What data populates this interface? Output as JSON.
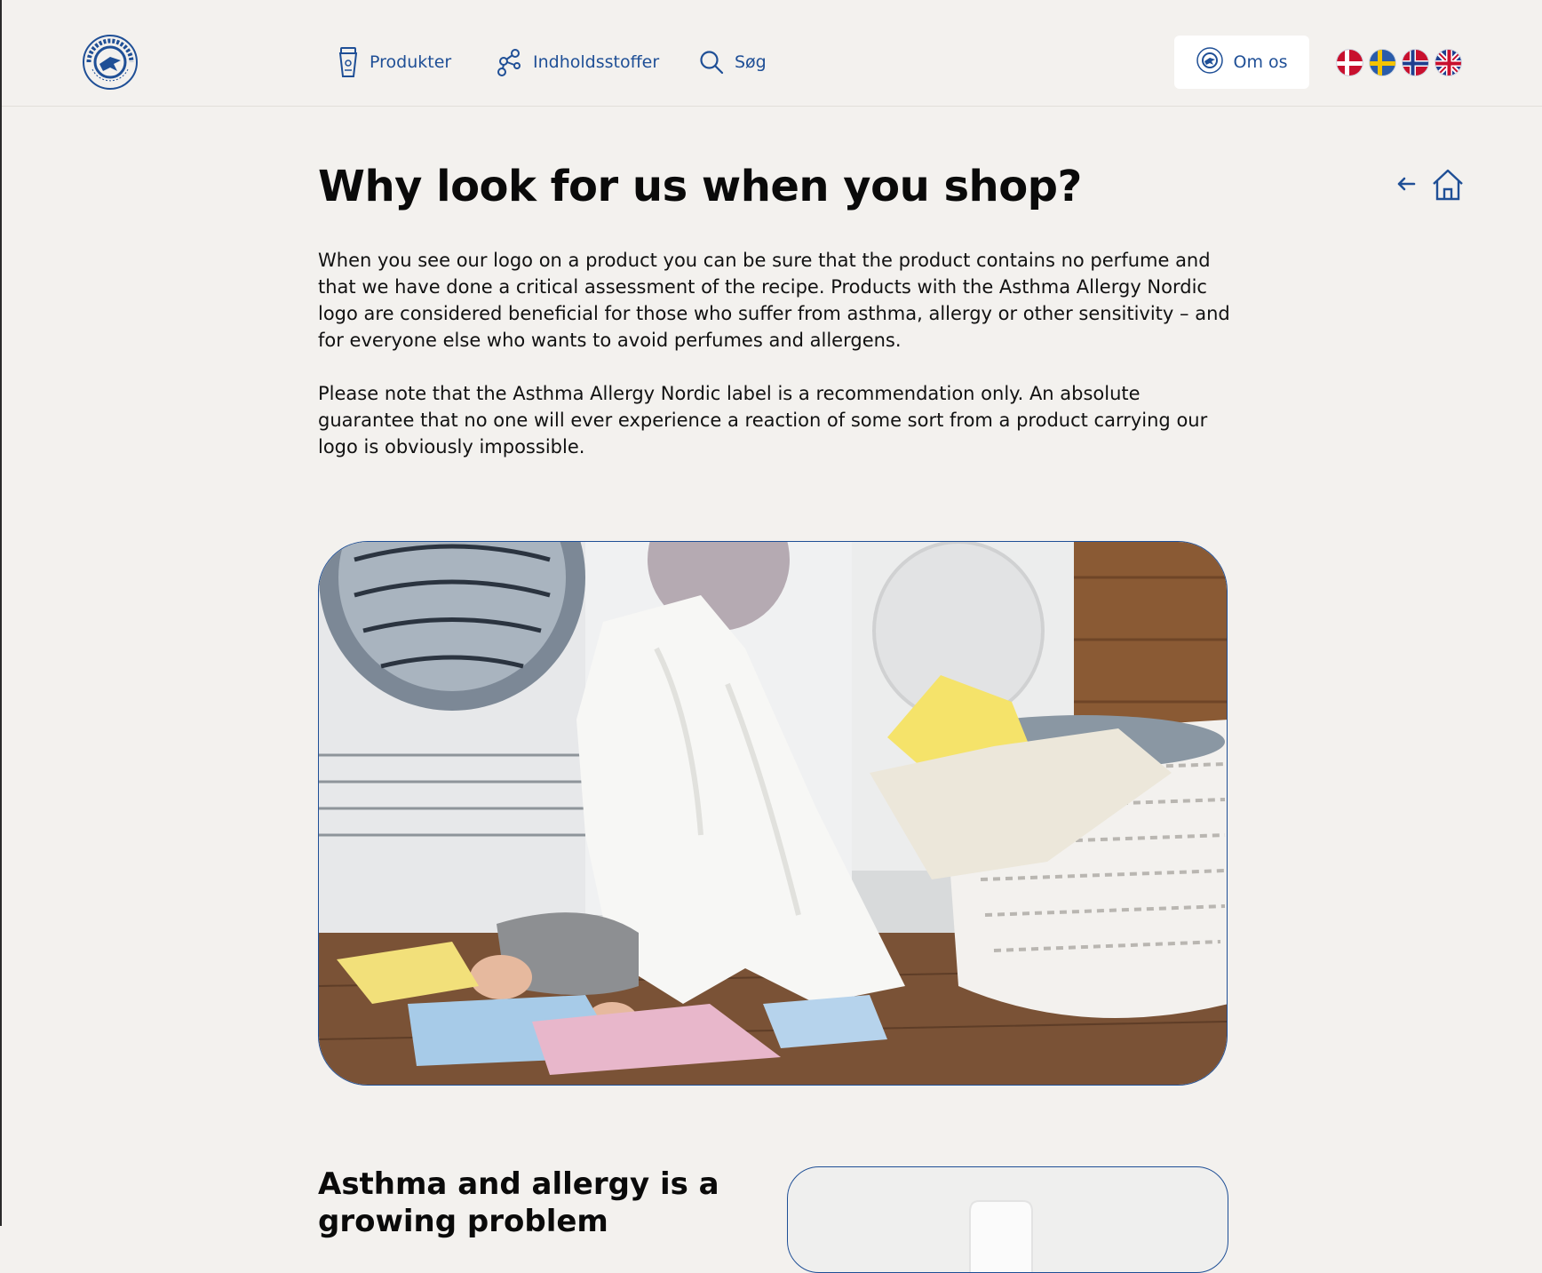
{
  "colors": {
    "accent": "#1f4f96",
    "background": "#f3f1ee",
    "text": "#111111"
  },
  "header": {
    "logo": {
      "icon": "asthma-allergy-nordic-seal",
      "text": "ASTHMA ALLERGY NORDIC · SELECTED WITH CARE"
    },
    "nav": [
      {
        "label": "Produkter",
        "icon": "product-tube-icon"
      },
      {
        "label": "Indholdsstoffer",
        "icon": "molecule-icon"
      },
      {
        "label": "Søg",
        "icon": "search-icon"
      }
    ],
    "about_label": "Om os",
    "languages": [
      {
        "code": "da",
        "icon": "flag-denmark"
      },
      {
        "code": "sv",
        "icon": "flag-sweden"
      },
      {
        "code": "no",
        "icon": "flag-norway"
      },
      {
        "code": "en",
        "icon": "flag-uk"
      }
    ]
  },
  "main": {
    "title": "Why look for us when you shop?",
    "paragraph1": "When you see our logo on a product you can be sure that the product contains no perfume and that we have done a critical assessment of the recipe. Products with the Asthma Allergy Nordic logo are considered beneficial for those who suffer from asthma, allergy or other sensitivity – and for everyone else who wants to avoid perfumes and allergens.",
    "paragraph2": "Please note that the Asthma Allergy Nordic label is a recommendation only. An absolute guarantee that no one will ever experience a reaction of some sort from a product carrying our logo is obviously impossible.",
    "hero_image": "baby-under-towel-in-laundry-room",
    "section_heading": "Asthma and allergy is a growing problem"
  }
}
